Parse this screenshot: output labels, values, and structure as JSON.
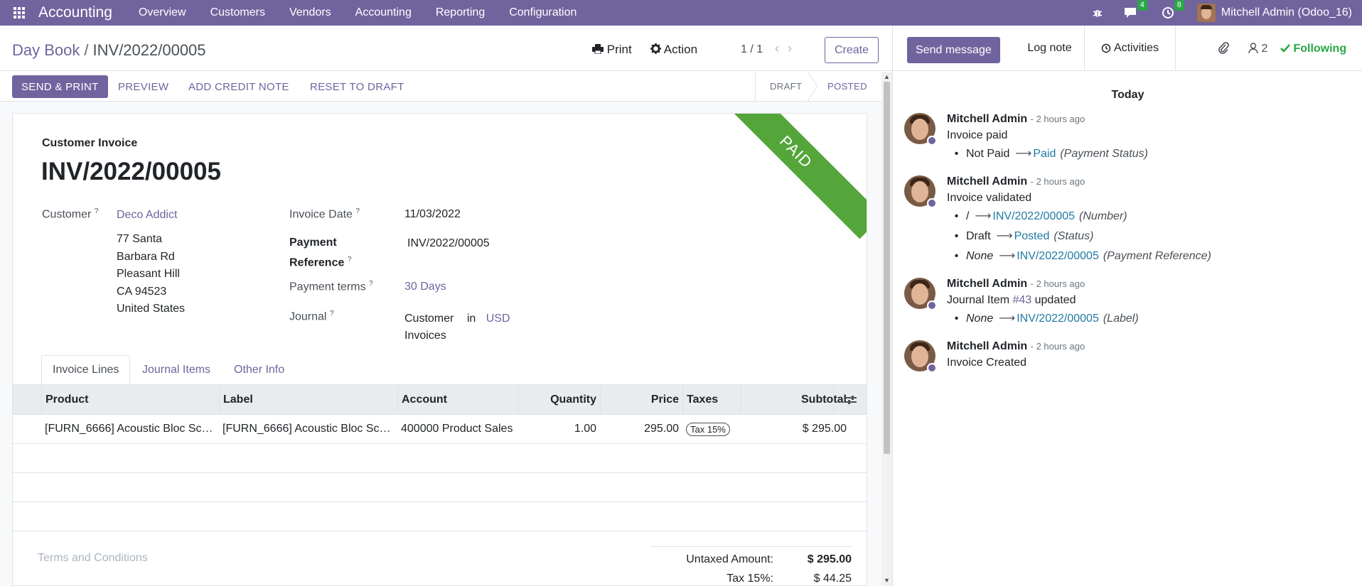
{
  "navbar": {
    "app_name": "Accounting",
    "menu": [
      "Overview",
      "Customers",
      "Vendors",
      "Accounting",
      "Reporting",
      "Configuration"
    ],
    "messages_count": "4",
    "activities_count": "8",
    "user": "Mitchell Admin (Odoo_16)"
  },
  "control": {
    "breadcrumb_parent": "Day Book",
    "breadcrumb_sep": "/",
    "breadcrumb_current": "INV/2022/00005",
    "print_label": "Print",
    "action_label": "Action",
    "pager": "1 / 1",
    "create_label": "Create"
  },
  "statusbar": {
    "send_print": "SEND & PRINT",
    "preview": "PREVIEW",
    "add_credit_note": "ADD CREDIT NOTE",
    "reset_to_draft": "RESET TO DRAFT",
    "stages": [
      "DRAFT",
      "POSTED"
    ],
    "active_stage": "POSTED"
  },
  "form": {
    "ribbon": "PAID",
    "doc_type": "Customer Invoice",
    "doc_name": "INV/2022/00005",
    "customer_label": "Customer",
    "customer_name": "Deco Addict",
    "customer_address": [
      "77 Santa",
      "Barbara Rd",
      "Pleasant Hill",
      "CA 94523",
      "United States"
    ],
    "invoice_date_label": "Invoice Date",
    "invoice_date": "11/03/2022",
    "payment_ref_label_1": "Payment",
    "payment_ref_label_2": "Reference",
    "payment_ref": "INV/2022/00005",
    "payment_terms_label": "Payment terms",
    "payment_terms": "30 Days",
    "journal_label": "Journal",
    "journal_line1": "Customer",
    "journal_in": "in",
    "journal_currency": "USD",
    "journal_line2": "Invoices",
    "tabs": [
      "Invoice Lines",
      "Journal Items",
      "Other Info"
    ],
    "active_tab": "Invoice Lines",
    "columns": [
      "Product",
      "Label",
      "Account",
      "Quantity",
      "Price",
      "Taxes",
      "Subtotal"
    ],
    "lines": [
      {
        "product": "[FURN_6666] Acoustic Bloc Sc…",
        "label": "[FURN_6666] Acoustic Bloc Sc…",
        "account": "400000 Product Sales",
        "quantity": "1.00",
        "price": "295.00",
        "taxes": "Tax 15%",
        "subtotal": "$ 295.00"
      }
    ],
    "terms_placeholder": "Terms and Conditions",
    "untaxed_label": "Untaxed Amount:",
    "untaxed_value": "$ 295.00",
    "tax_label": "Tax 15%:",
    "tax_value": "$ 44.25"
  },
  "chatter": {
    "send_message": "Send message",
    "log_note": "Log note",
    "activities": "Activities",
    "followers_count": "2",
    "following": "Following",
    "today": "Today",
    "messages": [
      {
        "author": "Mitchell Admin",
        "date": "- 2 hours ago",
        "body": "Invoice paid",
        "changes": [
          {
            "old": "Not Paid",
            "old_italic": false,
            "new": "Paid",
            "field": "(Payment Status)"
          }
        ]
      },
      {
        "author": "Mitchell Admin",
        "date": "- 2 hours ago",
        "body": "Invoice validated",
        "changes": [
          {
            "old": "/",
            "old_italic": false,
            "new": "INV/2022/00005",
            "field": "(Number)"
          },
          {
            "old": "Draft",
            "old_italic": false,
            "new": "Posted",
            "field": "(Status)"
          },
          {
            "old": "None",
            "old_italic": true,
            "new": "INV/2022/00005",
            "field": "(Payment Reference)"
          }
        ]
      },
      {
        "author": "Mitchell Admin",
        "date": "- 2 hours ago",
        "body_prefix": "Journal Item ",
        "body_link": "#43",
        "body_suffix": " updated",
        "changes": [
          {
            "old": "None",
            "old_italic": true,
            "new": "INV/2022/00005",
            "field": "(Label)"
          }
        ]
      },
      {
        "author": "Mitchell Admin",
        "date": "- 2 hours ago",
        "body": "Invoice Created",
        "changes": []
      }
    ]
  },
  "colors": {
    "brand": "#71639e",
    "paid_ribbon": "#54a53a",
    "following": "#28a745",
    "link_value": "#1f7aa1"
  }
}
